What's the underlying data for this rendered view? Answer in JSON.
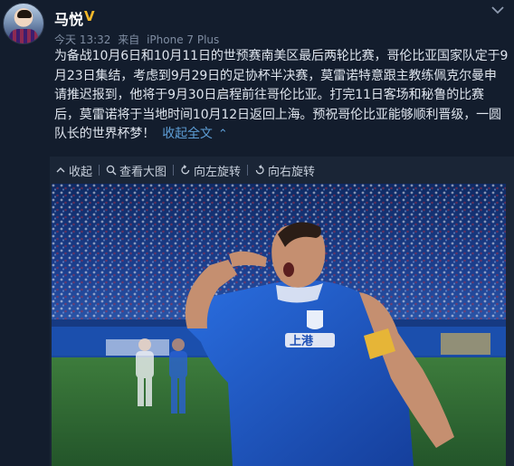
{
  "user": {
    "name": "马悦",
    "badge": "V"
  },
  "meta": {
    "time": "今天 13:32",
    "from": "来自",
    "device": "iPhone 7 Plus"
  },
  "post": {
    "lines": [
      "为备战10月6日和10月11日的世预赛南美区最后两轮比赛，哥伦比亚国家队定于9",
      "月23日集结，考虑到9月29日的足协杯半决赛，莫雷诺特意跟主教练佩克尔曼申",
      "请推迟报到，他将于9月30日启程前往哥伦比亚。打完11日客场和秘鲁的比赛",
      "后，莫雷诺将于当地时间10月12日返回上海。预祝哥伦比亚能够顺利晋级，一圆",
      "队长的世界杯梦！"
    ],
    "collapse_label": "收起全文",
    "collapse_icon": "up-caret-icon"
  },
  "toolbar": {
    "collapse": "收起",
    "view_large": "查看大图",
    "rotate_left": "向左旋转",
    "rotate_right": "向右旋转"
  },
  "photo": {
    "jersey_text": "上港",
    "colors": {
      "jersey": "#1d57c8",
      "pitch": "#2d6a35",
      "crowd": "#1c3f8f"
    }
  },
  "colors": {
    "background": "#131d2d",
    "link": "#5e9ed6",
    "meta": "#7f8da2",
    "badge": "#f6b92b"
  }
}
